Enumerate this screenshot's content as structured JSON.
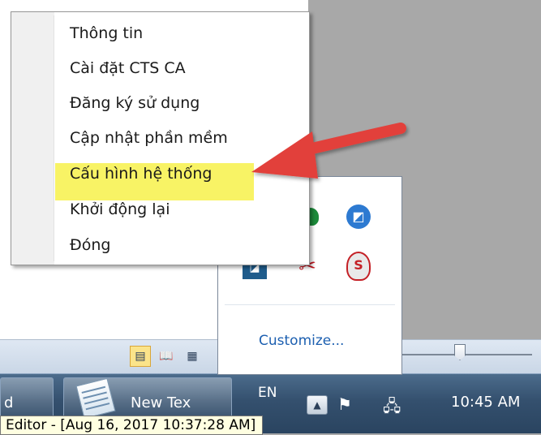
{
  "context_menu": {
    "items": [
      {
        "label": "Thông tin"
      },
      {
        "label": "Cài đặt CTS CA"
      },
      {
        "label": "Đăng ký sử dụng"
      },
      {
        "label": "Cập nhật phần mềm"
      },
      {
        "label": "Cấu hình hệ thống",
        "highlighted": true
      },
      {
        "label": "Khởi động lại"
      },
      {
        "label": "Đóng"
      }
    ],
    "highlight_color": "#f7f14a"
  },
  "annotation": {
    "arrow_color": "#e2403a"
  },
  "tray_overflow": {
    "customize_label": "Customize...",
    "icons": [
      "green-app-icon",
      "blue-chat-icon",
      "dark-app-icon",
      "red-tool-icon",
      "s-badge-icon"
    ]
  },
  "status_bar": {
    "view_buttons": [
      "normal-view-icon",
      "reading-view-icon",
      "web-view-icon"
    ],
    "active_view": "normal-view-icon"
  },
  "taskbar": {
    "button1_label": "d",
    "button2_label": "New Tex",
    "language": "EN",
    "clock": "10:45 AM",
    "tray_icons": [
      "flag-icon",
      "network-icon"
    ]
  },
  "tooltip": {
    "text": "Editor - [Aug 16, 2017 10:37:28 AM]"
  }
}
